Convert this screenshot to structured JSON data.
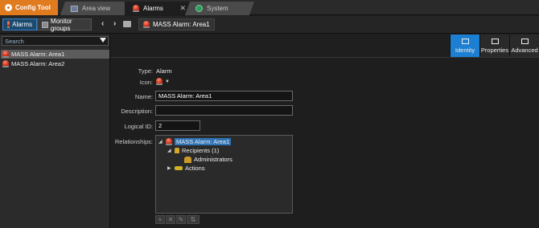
{
  "app": {
    "title": "Config Tool"
  },
  "tabs": [
    {
      "label": "Area view",
      "icon": "area-view-icon",
      "active": false
    },
    {
      "label": "Alarms",
      "icon": "alarm-icon",
      "active": true,
      "close": "✕"
    },
    {
      "label": "System",
      "icon": "system-icon",
      "active": false
    }
  ],
  "toolbar": {
    "alarms_label": "Alarms",
    "monitor_label": "Monitor groups",
    "back": "‹",
    "forward": "›",
    "crumb": "MASS Alarm: Area1"
  },
  "search": {
    "placeholder": "Search"
  },
  "entities": [
    {
      "label": "MASS Alarm: Area1",
      "selected": true
    },
    {
      "label": "MASS Alarm: Area2",
      "selected": false
    }
  ],
  "views": [
    {
      "label": "Identity",
      "active": true
    },
    {
      "label": "Properties",
      "active": false
    },
    {
      "label": "Advanced",
      "active": false
    }
  ],
  "form": {
    "type_label": "Type:",
    "type_value": "Alarm",
    "icon_label": "Icon:",
    "name_label": "Name:",
    "name_value": "MASS Alarm: Area1",
    "description_label": "Description:",
    "description_value": "",
    "logical_id_label": "Logical ID:",
    "logical_id_value": "2",
    "relationships_label": "Relationships:"
  },
  "relationships": {
    "root": "MASS Alarm: Area1",
    "recipients": "Recipients (1)",
    "administrators": "Administrators",
    "actions": "Actions"
  },
  "colors": {
    "accent": "#e07b1f",
    "selection": "#1c7fd1",
    "alarms_button": "#1c4a6e"
  }
}
